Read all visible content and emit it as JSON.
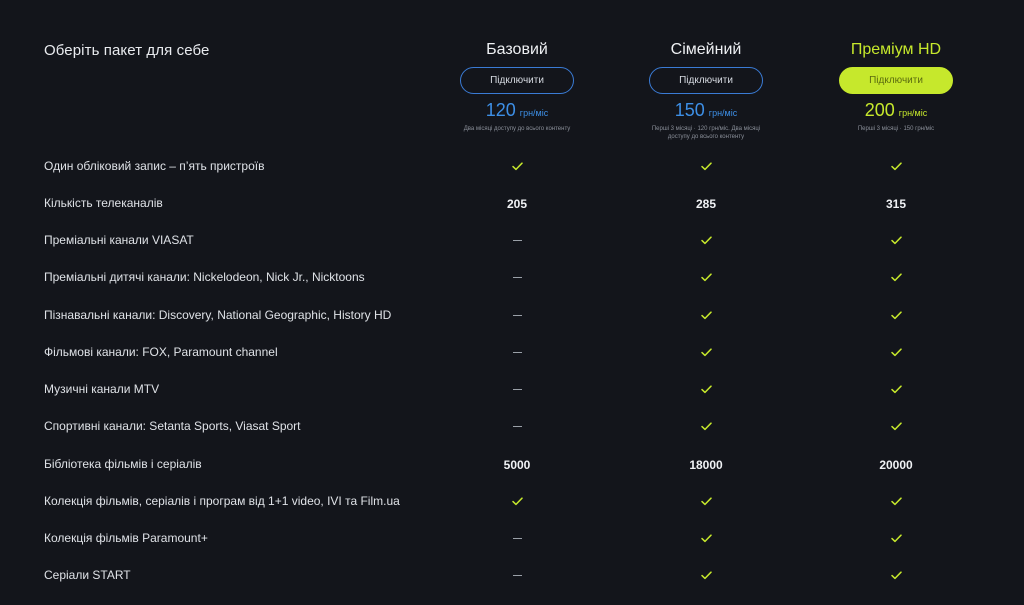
{
  "title": "Оберіть пакет для себе",
  "plans": [
    {
      "name": "Базовий",
      "button": "Підключити",
      "price": "120",
      "unit": "грн/міс",
      "note": "Два місяці доступу до всього контенту"
    },
    {
      "name": "Сімейний",
      "button": "Підключити",
      "price": "150",
      "unit": "грн/міс",
      "note": "Перші 3 місяці · 120 грн/міс. Два місяці доступу до всього контенту"
    },
    {
      "name": "Преміум HD",
      "button": "Підключити",
      "price": "200",
      "unit": "грн/міс",
      "note": "Перші 3 місяці · 150 грн/міс"
    }
  ],
  "rows": [
    {
      "label": "Один обліковий запис – п’ять пристроїв",
      "values": [
        "check",
        "check",
        "check"
      ]
    },
    {
      "label": "Кількість телеканалів",
      "values": [
        "205",
        "285",
        "315"
      ]
    },
    {
      "label": "Преміальні канали VIASAT",
      "values": [
        "dash",
        "check",
        "check"
      ]
    },
    {
      "label": "Преміальні дитячі канали: Nickelodeon, Nick Jr., Nicktoons",
      "values": [
        "dash",
        "check",
        "check"
      ]
    },
    {
      "label": "Пізнавальні канали: Discovery, National Geographic, History HD",
      "values": [
        "dash",
        "check",
        "check"
      ]
    },
    {
      "label": "Фільмові канали: FOX, Paramount channel",
      "values": [
        "dash",
        "check",
        "check"
      ]
    },
    {
      "label": "Музичні канали MTV",
      "values": [
        "dash",
        "check",
        "check"
      ]
    },
    {
      "label": "Спортивні канали: Setanta Sports, Viasat Sport",
      "values": [
        "dash",
        "check",
        "check"
      ]
    },
    {
      "label": "Бібліотека фільмів і серіалів",
      "values": [
        "5000",
        "18000",
        "20000"
      ]
    },
    {
      "label": "Колекція фільмів, серіалів і програм від 1+1 video, IVI та Film.ua",
      "values": [
        "check",
        "check",
        "check"
      ]
    },
    {
      "label": "Колекція фільмів Paramount+",
      "values": [
        "dash",
        "check",
        "check"
      ]
    },
    {
      "label": "Серіали START",
      "values": [
        "dash",
        "check",
        "check"
      ]
    }
  ],
  "colors": {
    "accent": "#c6e82c",
    "blue": "#3d8fe6",
    "background": "#13151b"
  }
}
